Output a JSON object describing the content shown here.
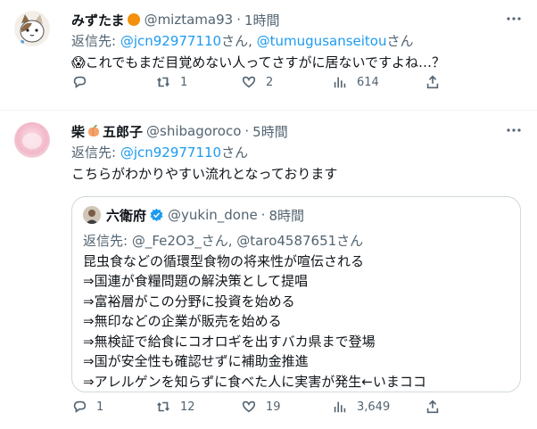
{
  "tweet1": {
    "display_name": "みずたま",
    "handle": "@miztama93",
    "time": "1時間",
    "reply_prefix": "返信先: ",
    "reply_to_1": "@jcn92977110",
    "reply_sep": "さん, ",
    "reply_to_2": "@tumugusanseitou",
    "reply_suffix": "さん",
    "emoji": "😱",
    "text": "これでもまだ目覚めない人ってさすがに居ないですよね…？",
    "replies": "",
    "retweets": "1",
    "likes": "2",
    "views": "614"
  },
  "tweet2": {
    "display_name_a": "柴",
    "display_name_b": "五郎子",
    "handle": "@shibagoroco",
    "time": "5時間",
    "reply_prefix": "返信先: ",
    "reply_to_1": "@jcn92977110",
    "reply_suffix": "さん",
    "text": "こちらがわかりやすい流れとなっております",
    "replies": "1",
    "retweets": "12",
    "likes": "19",
    "views": "3,649"
  },
  "quote": {
    "display_name": "六衛府",
    "handle": "@yukin_done",
    "time": "8時間",
    "reply_line": "返信先: @_Fe2O3_さん, @taro4587651さん",
    "lines": [
      "昆虫食などの循環型食物の将来性が喧伝される",
      "⇒国連が食糧問題の解決策として提唱",
      "⇒富裕層がこの分野に投資を始める",
      "⇒無印などの企業が販売を始める",
      "⇒無検証で給食にコオロギを出すバカ県まで登場",
      "⇒国が安全性も確認せずに補助金推進",
      "⇒アレルゲンを知らずに食べた人に実害が発生←いまココ"
    ]
  },
  "separator": "·",
  "colors": {
    "accent": "#1d9bf0",
    "muted": "#536471",
    "border": "#cfd9de"
  },
  "icons": [
    "reply-icon",
    "retweet-icon",
    "like-icon",
    "views-icon",
    "share-icon",
    "more-icon",
    "verified-icon",
    "orange-circle-icon",
    "peach-icon"
  ]
}
